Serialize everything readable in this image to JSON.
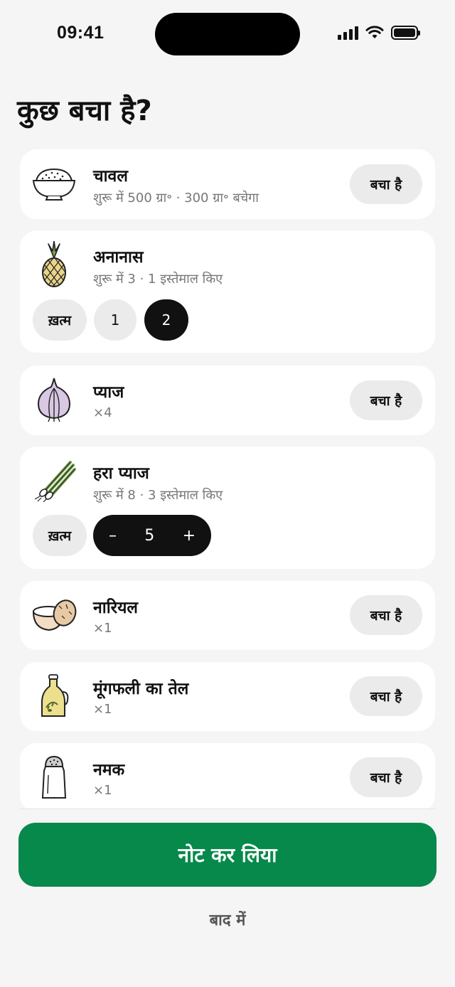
{
  "status_bar": {
    "time": "09:41"
  },
  "title": "कुछ बचा है?",
  "items": [
    {
      "name": "चावल",
      "sub": "शुरू में 500 ग्रा॰ · 300 ग्रा॰ बचेगा",
      "action": "बचा है",
      "icon": "rice-bowl-icon"
    },
    {
      "name": "अनानास",
      "sub": "शुरू में 3 · 1 इस्तेमाल किए",
      "icon": "pineapple-icon",
      "done_label": "ख़त्म",
      "options": [
        "1",
        "2"
      ],
      "selected": "2"
    },
    {
      "name": "प्याज",
      "sub": "×4",
      "action": "बचा है",
      "icon": "onion-icon"
    },
    {
      "name": "हरा प्याज",
      "sub": "शुरू में 8 · 3 इस्तेमाल किए",
      "icon": "green-onion-icon",
      "done_label": "ख़त्म",
      "stepper": {
        "minus": "–",
        "value": "5",
        "plus": "+"
      }
    },
    {
      "name": "नारियल",
      "sub": "×1",
      "action": "बचा है",
      "icon": "coconut-icon"
    },
    {
      "name": "मूंगफली का तेल",
      "sub": "×1",
      "action": "बचा है",
      "icon": "oil-bottle-icon"
    },
    {
      "name": "नमक",
      "sub": "×1",
      "action": "बचा है",
      "icon": "salt-shaker-icon"
    }
  ],
  "primary_action": "नोट कर लिया",
  "secondary_action": "बाद में",
  "colors": {
    "primary": "#06894a",
    "background": "#f5f5f5",
    "card": "#ffffff"
  }
}
